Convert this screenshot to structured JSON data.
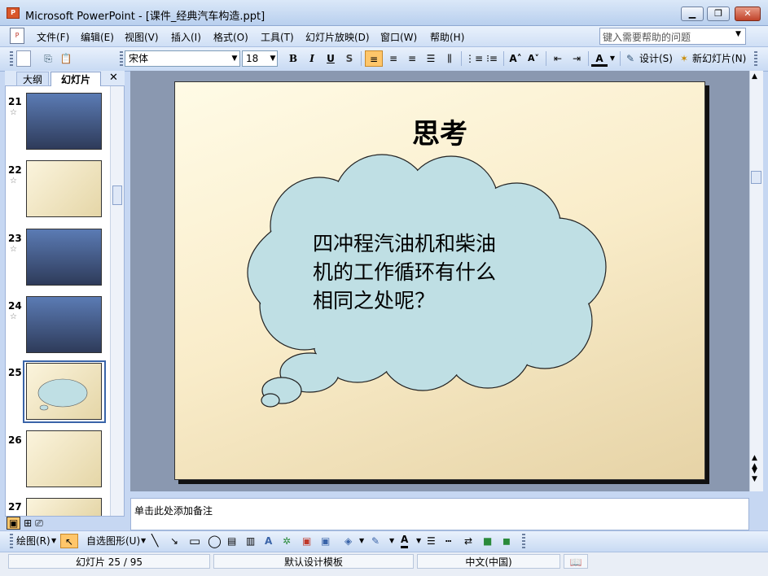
{
  "window": {
    "title": "Microsoft PowerPoint - [课件_经典汽车构造.ppt]",
    "app_icon": "powerpoint-icon"
  },
  "window_buttons": {
    "minimize": "▁",
    "restore": "❐",
    "close": "✕"
  },
  "menu": {
    "items": [
      "文件(F)",
      "编辑(E)",
      "视图(V)",
      "插入(I)",
      "格式(O)",
      "工具(T)",
      "幻灯片放映(D)",
      "窗口(W)",
      "帮助(H)"
    ],
    "help_placeholder": "键入需要帮助的问题"
  },
  "toolbar": {
    "font_name": "宋体",
    "font_size": "18",
    "bold": "B",
    "italic": "I",
    "underline": "U",
    "shadow": "S",
    "design": "设计(S)",
    "new_slide": "新幻灯片(N)"
  },
  "panel": {
    "tabs": [
      "大纲",
      "幻灯片"
    ],
    "close": "✕",
    "selected_slide": 25,
    "slides": [
      {
        "num": "21",
        "star": "☆"
      },
      {
        "num": "22",
        "star": "☆"
      },
      {
        "num": "23",
        "star": "☆"
      },
      {
        "num": "24",
        "star": "☆"
      },
      {
        "num": "25",
        "star": ""
      },
      {
        "num": "26",
        "star": ""
      },
      {
        "num": "27",
        "star": ""
      }
    ]
  },
  "slide": {
    "title": "思考",
    "body_lines": [
      "四冲程汽油机和柴油",
      "机的工作循环有什么",
      "相同之处呢？"
    ],
    "bubble_fill": "#bfdfe4"
  },
  "notes": {
    "placeholder": "单击此处添加备注"
  },
  "drawbar": {
    "draw": "绘图(R)",
    "autoshapes": "自选图形(U)"
  },
  "status": {
    "slide_pos": "幻灯片 25 / 95",
    "template": "默认设计模板",
    "language": "中文(中国)"
  },
  "colors": {
    "accent": "#3a64a8",
    "titlebar": "#c6d7f2"
  }
}
